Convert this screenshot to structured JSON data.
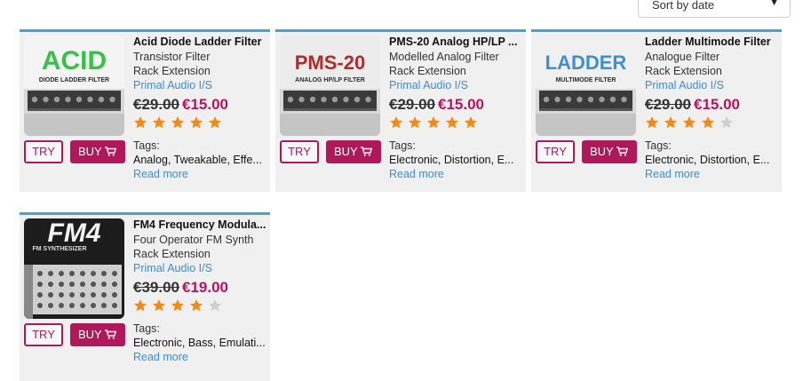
{
  "sort": {
    "label": "Sort by date",
    "arrow": "▼"
  },
  "colors": {
    "accent": "#b0185c",
    "link": "#3a8dd6",
    "top_border": "#4a9fd3",
    "star_on": "#f08a18",
    "star_off": "#cfcfcf"
  },
  "products": [
    {
      "title": "Acid Diode Ladder Filter",
      "subtitle": "Transistor Filter",
      "category": "Rack Extension",
      "vendor": "Primal Audio I/S",
      "old_price": "€29.00",
      "new_price": "€15.00",
      "rating": 5,
      "try_label": "TRY",
      "buy_label": "BUY",
      "tags_label": "Tags:",
      "tags": [
        "Analog",
        "Tweakable",
        "Effe..."
      ],
      "read_more": "Read more",
      "thumb": {
        "big": "ACID",
        "small": "DIODE LADDER FILTER",
        "big_color": "#39c04a",
        "small_color": "#2a2a2a",
        "bg": "#f4f4f4"
      }
    },
    {
      "title": "PMS-20 Analog HP/LP ...",
      "subtitle": "Modelled Analog Filter",
      "category": "Rack Extension",
      "vendor": "Primal Audio I/S",
      "old_price": "€29.00",
      "new_price": "€15.00",
      "rating": 5,
      "try_label": "TRY",
      "buy_label": "BUY",
      "tags_label": "Tags:",
      "tags": [
        "Electronic",
        "Distortion",
        "E..."
      ],
      "read_more": "Read more",
      "thumb": {
        "big": "PMS-20",
        "small": "ANALOG HP/LP FILTER",
        "big_color": "#b22a2a",
        "small_color": "#2a2a2a",
        "bg": "#ececec"
      }
    },
    {
      "title": "Ladder Multimode Filter",
      "subtitle": "Analogue Filter",
      "category": "Rack Extension",
      "vendor": "Primal Audio I/S",
      "old_price": "€29.00",
      "new_price": "€15.00",
      "rating": 4,
      "try_label": "TRY",
      "buy_label": "BUY",
      "tags_label": "Tags:",
      "tags": [
        "Electronic",
        "Distortion",
        "E..."
      ],
      "read_more": "Read more",
      "thumb": {
        "big": "LADDER",
        "small": "MULTIMODE FILTER",
        "big_color": "#3d8fd0",
        "small_color": "#2a2a2a",
        "bg": "#f0f0f0"
      }
    },
    {
      "title": "FM4 Frequency Modula...",
      "subtitle": "Four Operator FM Synth",
      "category": "Rack Extension",
      "vendor": "Primal Audio I/S",
      "old_price": "€39.00",
      "new_price": "€19.00",
      "rating": 4,
      "try_label": "TRY",
      "buy_label": "BUY",
      "tags_label": "Tags:",
      "tags": [
        "Electronic",
        "Bass",
        "Emulati..."
      ],
      "read_more": "Read more",
      "thumb": {
        "big": "FM4",
        "small": "FM SYNTHESIZER",
        "big_color": "#f2f2f2",
        "small_color": "#dddddd",
        "bg": "#1c1c1c"
      }
    }
  ]
}
